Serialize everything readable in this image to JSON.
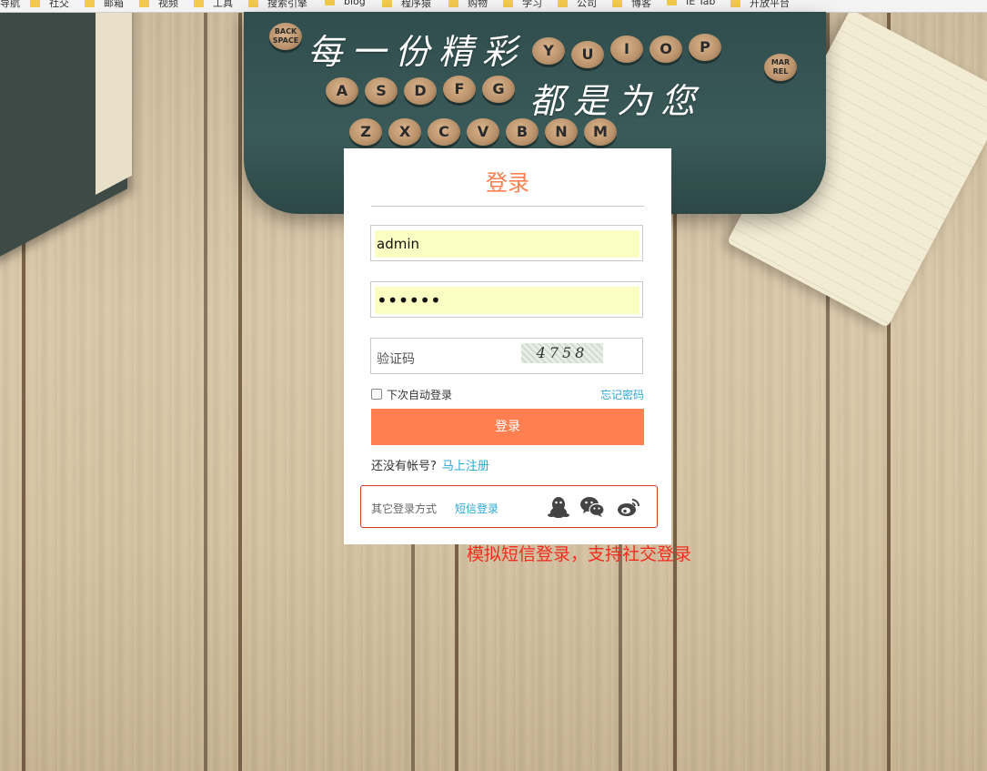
{
  "bookmarks": [
    "导航",
    "社交",
    "邮箱",
    "视频",
    "工具",
    "搜索引擎",
    "blog",
    "程序猿",
    "购物",
    "学习",
    "公司",
    "博客",
    "IE Tab",
    "开放平台"
  ],
  "headline": {
    "line1": "每一份精彩",
    "line2": "都是为您"
  },
  "typewriter": {
    "row1": [
      "Y",
      "U",
      "I",
      "O",
      "P"
    ],
    "row2": [
      "A",
      "S",
      "D",
      "F",
      "G"
    ],
    "row3": [
      "Z",
      "X",
      "C",
      "V",
      "B",
      "N",
      "M"
    ],
    "back_space": "BACK SPACE",
    "mar_rel": "MAR REL"
  },
  "login": {
    "title": "登录",
    "username_value": "admin",
    "password_value": "••••••",
    "captcha_placeholder": "验证码",
    "captcha_text": "4758",
    "remember_label": "下次自动登录",
    "forgot_label": "忘记密码",
    "submit_label": "登录",
    "no_account": "还没有帐号?",
    "register_link": "马上注册",
    "other_methods": "其它登录方式",
    "sms_login": "短信登录"
  },
  "annotation": "模拟短信登录，支持社交登录",
  "colors": {
    "accent": "#ff7f50",
    "link": "#2aa7d6",
    "autofill": "#fbfdc3",
    "annotation": "#f32b1c"
  },
  "icons": {
    "qq": "qq-icon",
    "wechat": "wechat-icon",
    "weibo": "weibo-icon"
  }
}
